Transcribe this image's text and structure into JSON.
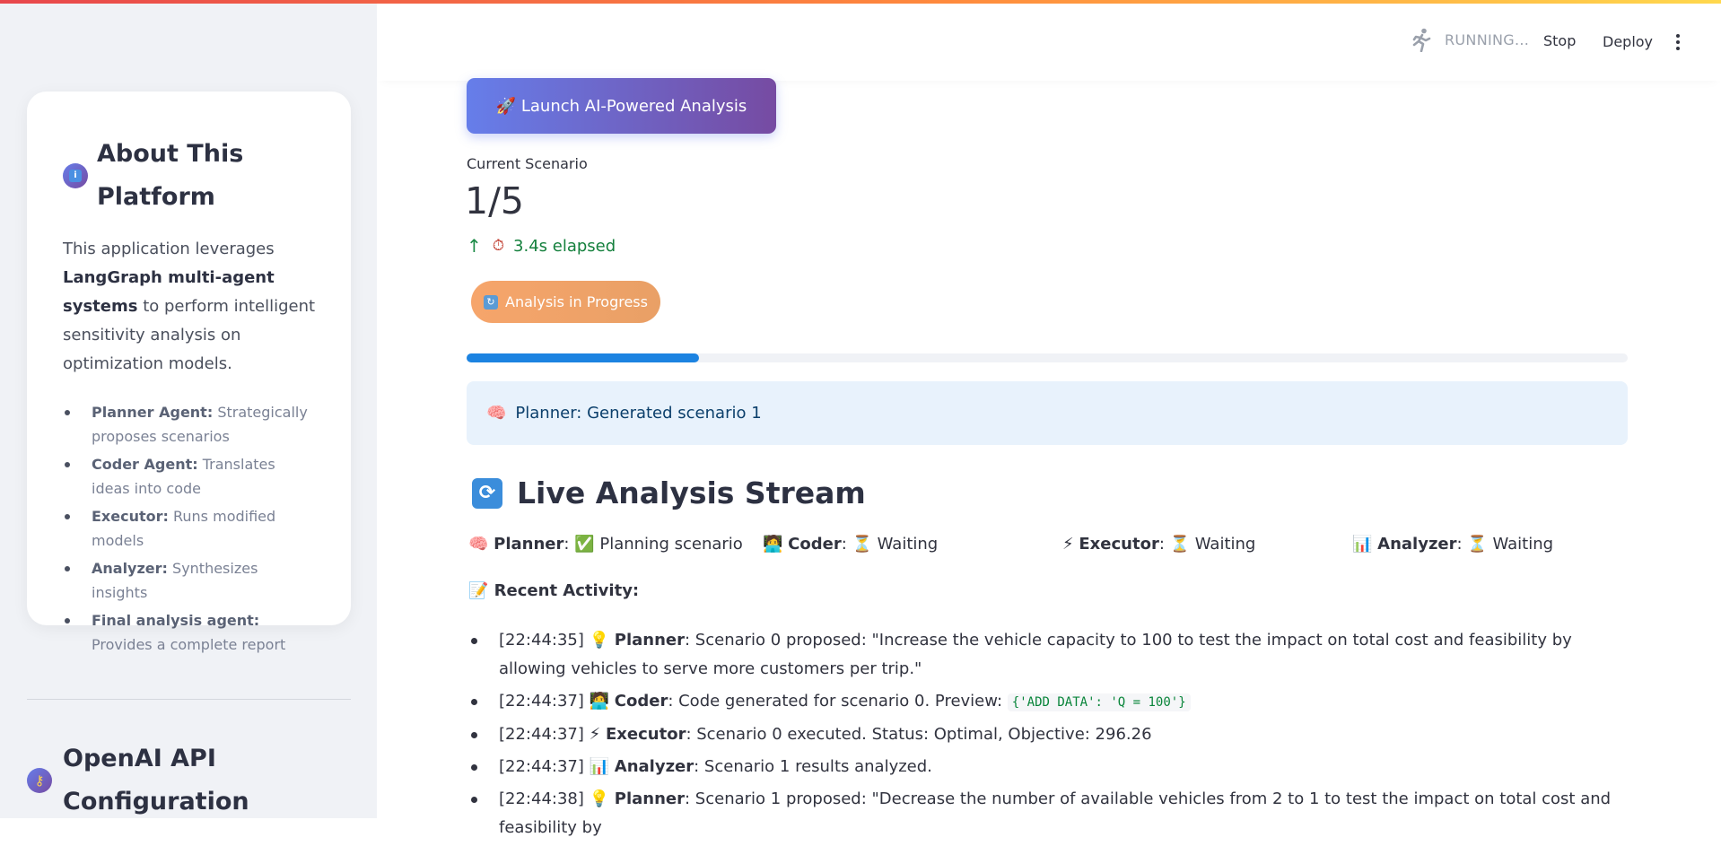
{
  "sidebar": {
    "about": {
      "title": "About This Platform",
      "desc_pre": "This application leverages",
      "desc_bold": "LangGraph multi-agent systems",
      "desc_post": "to perform intelligent sensitivity analysis on optimization models.",
      "agents": [
        {
          "name": "Planner Agent:",
          "text": "Strategically proposes scenarios"
        },
        {
          "name": "Coder Agent:",
          "text": "Translates ideas into code"
        },
        {
          "name": "Executor:",
          "text": "Runs modified models"
        },
        {
          "name": "Analyzer:",
          "text": "Synthesizes insights"
        },
        {
          "name": "Final analysis agent:",
          "text": "Provides a complete report"
        }
      ]
    },
    "api": {
      "title": "OpenAI API Configuration"
    }
  },
  "header": {
    "status": "RUNNING...",
    "stop_label": "Stop",
    "deploy_label": "Deploy"
  },
  "main": {
    "launch_label": "🚀 Launch AI-Powered Analysis",
    "metric": {
      "label": "Current Scenario",
      "value": "1/5",
      "delta_icon": "⏱",
      "delta_text": "3.4s elapsed"
    },
    "status_pill": "Analysis in Progress",
    "progress": 0.2,
    "alert": {
      "icon": "🧠",
      "text": "Planner: Generated scenario 1"
    },
    "stream_title": "Live Analysis Stream",
    "agents": [
      {
        "icon": "🧠",
        "name": "Planner",
        "state_icon": "✅",
        "state": "Planning scenario"
      },
      {
        "icon": "🧑‍💻",
        "name": "Coder",
        "state_icon": "⏳",
        "state": "Waiting"
      },
      {
        "icon": "⚡",
        "name": "Executor",
        "state_icon": "⏳",
        "state": "Waiting"
      },
      {
        "icon": "📊",
        "name": "Analyzer",
        "state_icon": "⏳",
        "state": "Waiting"
      }
    ],
    "recent_label": "📝 Recent Activity:",
    "activity": [
      {
        "time": "[22:44:35]",
        "icon": "💡",
        "agent": "Planner",
        "text": ": Scenario 0 proposed: \"Increase the vehicle capacity to 100 to test the impact on total cost and feasibility by allowing vehicles to serve more customers per trip.\"",
        "code": ""
      },
      {
        "time": "[22:44:37]",
        "icon": "🧑‍💻",
        "agent": "Coder",
        "text": ": Code generated for scenario 0. Preview:",
        "code": "{'ADD DATA': 'Q = 100'}"
      },
      {
        "time": "[22:44:37]",
        "icon": "⚡",
        "agent": "Executor",
        "text": ": Scenario 0 executed. Status: Optimal, Objective: 296.26",
        "code": ""
      },
      {
        "time": "[22:44:37]",
        "icon": "📊",
        "agent": "Analyzer",
        "text": ": Scenario 1 results analyzed.",
        "code": ""
      },
      {
        "time": "[22:44:38]",
        "icon": "💡",
        "agent": "Planner",
        "text": ": Scenario 1 proposed: \"Decrease the number of available vehicles from 2 to 1 to test the impact on total cost and feasibility by",
        "code": ""
      }
    ]
  }
}
